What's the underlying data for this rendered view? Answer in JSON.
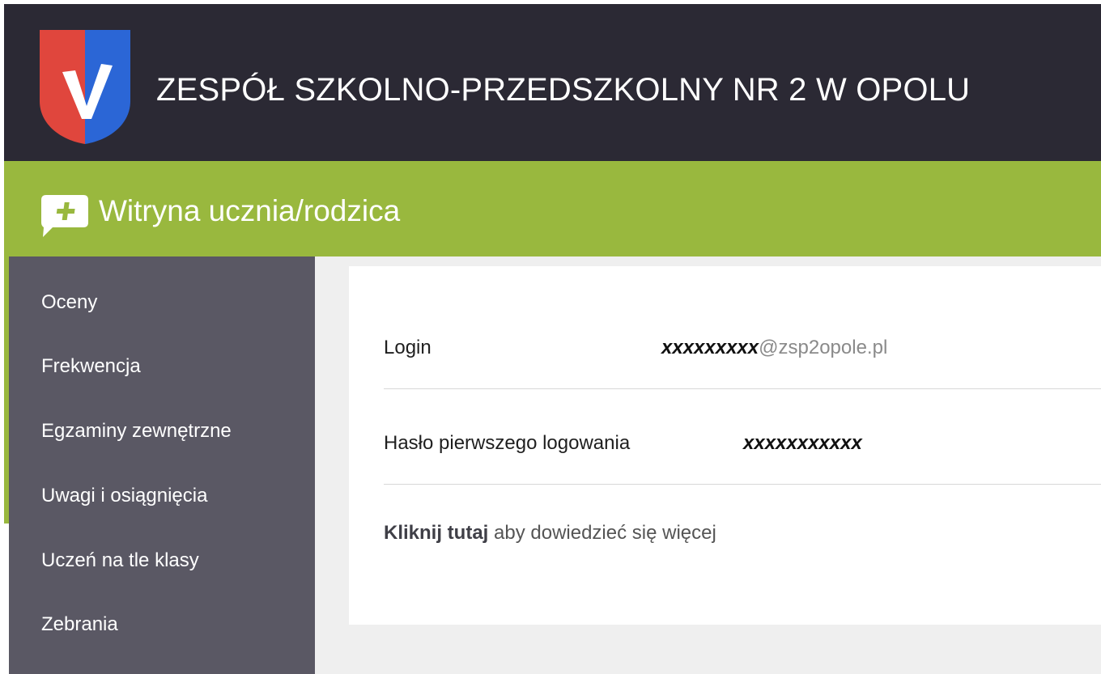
{
  "header": {
    "school_name": "ZESPÓŁ SZKOLNO-PRZEDSZKOLNY NR 2 W OPOLU",
    "logo_icon": "shield-v-logo-icon",
    "logo_colors": {
      "left": "#e0463d",
      "right": "#2b66d6",
      "mark": "#ffffff"
    }
  },
  "app_bar": {
    "title": "Witryna ucznia/rodzica",
    "icon": "chat-plus-icon",
    "color": "#99b83e"
  },
  "sidebar": {
    "items": [
      {
        "label": "Oceny"
      },
      {
        "label": "Frekwencja"
      },
      {
        "label": "Egzaminy zewnętrzne"
      },
      {
        "label": "Uwagi i osiągnięcia"
      },
      {
        "label": "Uczeń na tle klasy"
      },
      {
        "label": "Zebrania"
      }
    ]
  },
  "account": {
    "login_label": "Login",
    "login_user": "xxxxxxxxx",
    "login_domain": "@zsp2opole.pl",
    "password_label": "Hasło pierwszego logowania",
    "password_value": "xxxxxxxxxxx",
    "info_link": "Kliknij tutaj",
    "info_text": " aby dowiedzieć się więcej"
  }
}
